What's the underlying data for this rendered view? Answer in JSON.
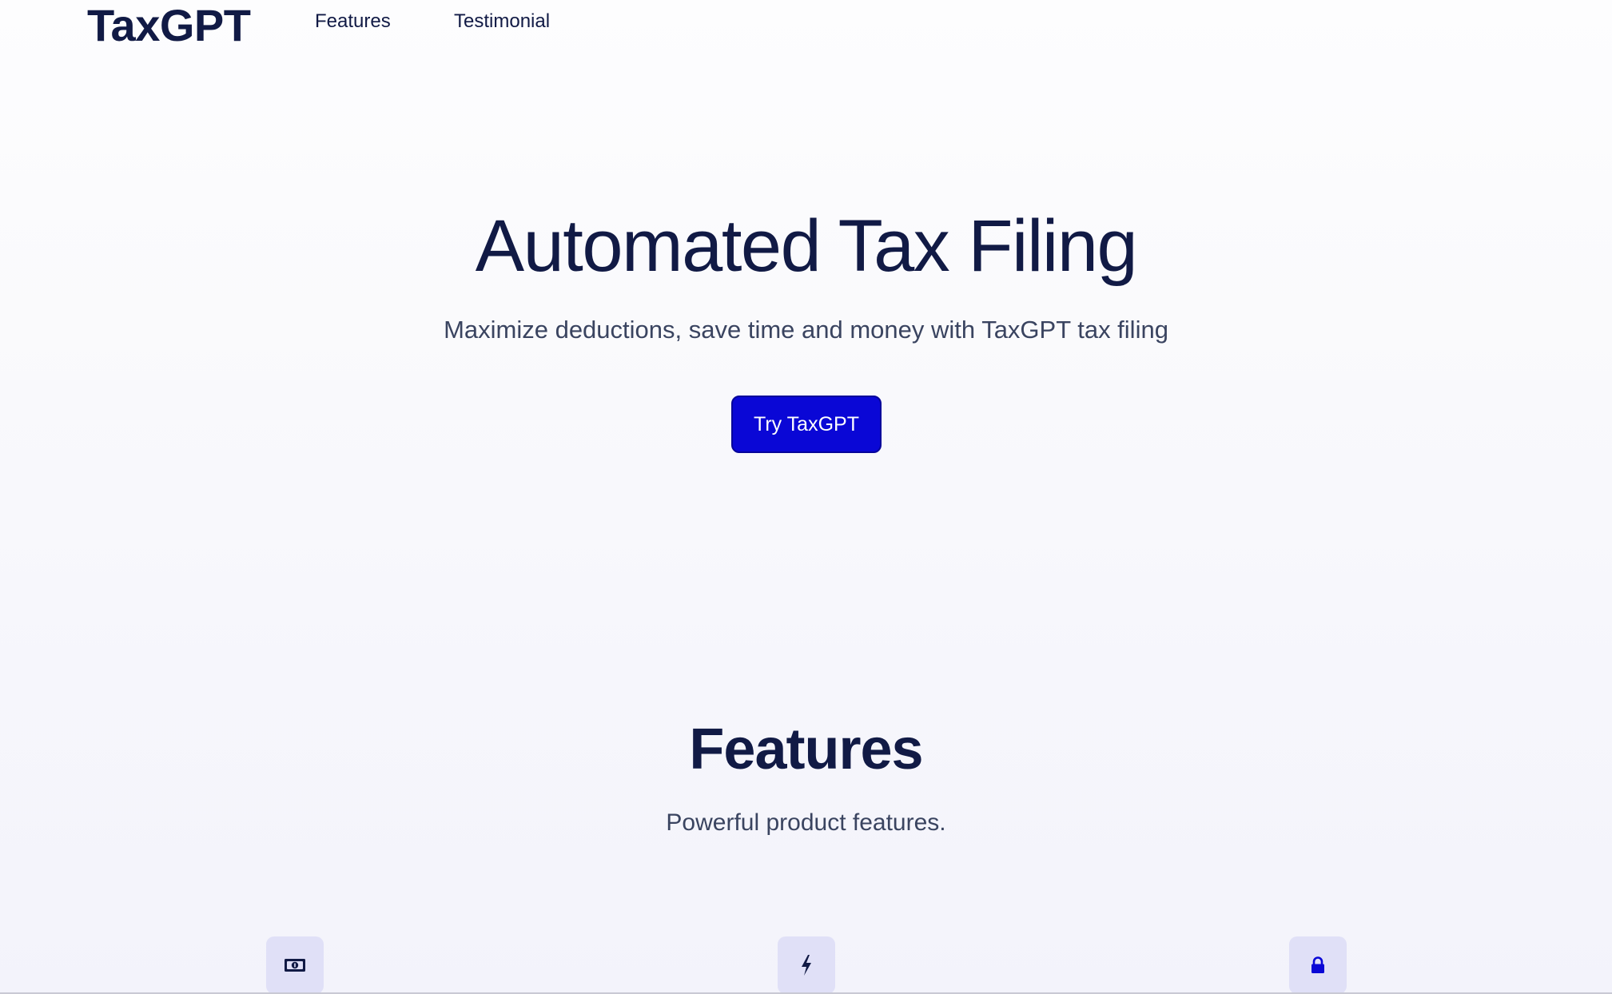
{
  "navbar": {
    "logo": "TaxGPT",
    "links": [
      "Features",
      "Testimonial"
    ]
  },
  "hero": {
    "title": "Automated Tax Filing",
    "subtitle": "Maximize deductions, save time and money with TaxGPT tax filing",
    "cta_label": "Try TaxGPT"
  },
  "features": {
    "title": "Features",
    "subtitle": "Powerful product features.",
    "icons": [
      "money-bill-icon",
      "lightning-bolt-icon",
      "lock-icon"
    ]
  },
  "colors": {
    "brand": "#0a07d6",
    "text_dark": "#111a45",
    "text_muted": "#3a4460",
    "icon_bg": "#e0e0f7"
  }
}
